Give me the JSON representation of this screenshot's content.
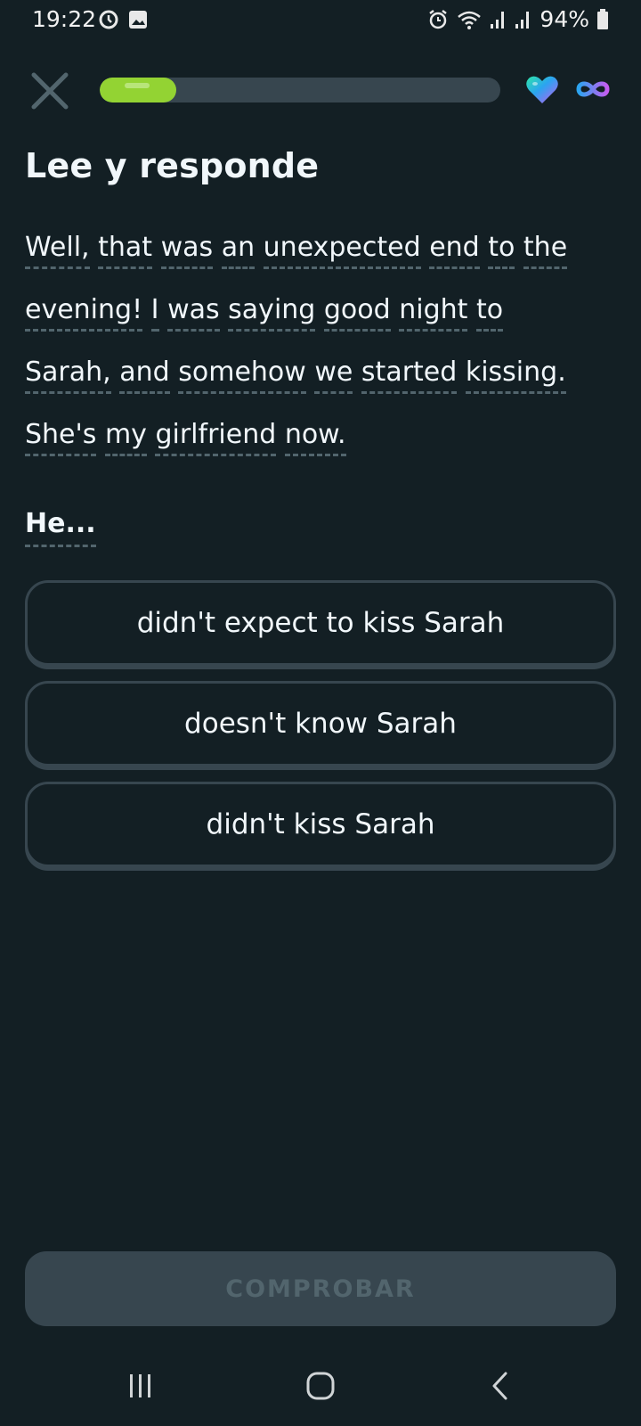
{
  "status_bar": {
    "time": "19:22",
    "battery": "94%",
    "left_icons": [
      "sync-icon",
      "image-icon"
    ],
    "right_icons": [
      "alarm-icon",
      "wifi-icon",
      "signal-icon",
      "signal-icon",
      "battery-icon"
    ]
  },
  "header": {
    "progress_fraction": 0.19,
    "hearts": "infinite",
    "colors": {
      "progress": "#93d333",
      "track": "#37464f"
    }
  },
  "lesson": {
    "title": "Lee y responde",
    "passage_lines": [
      [
        "Well,",
        "that",
        "was",
        "an",
        "unexpected",
        "end",
        "to",
        "the"
      ],
      [
        "evening!",
        "I",
        "was",
        "saying",
        "good",
        "night",
        "to"
      ],
      [
        "Sarah,",
        "and",
        "somehow",
        "we",
        "started",
        "kissing."
      ],
      [
        "She's",
        "my",
        "girlfriend",
        "now."
      ]
    ],
    "question": "He...",
    "options": [
      "didn't expect to kiss Sarah",
      "doesn't know Sarah",
      "didn't kiss Sarah"
    ],
    "check_button": "COMPROBAR"
  },
  "nav_bar": {
    "items": [
      "recent-apps",
      "home",
      "back"
    ]
  }
}
